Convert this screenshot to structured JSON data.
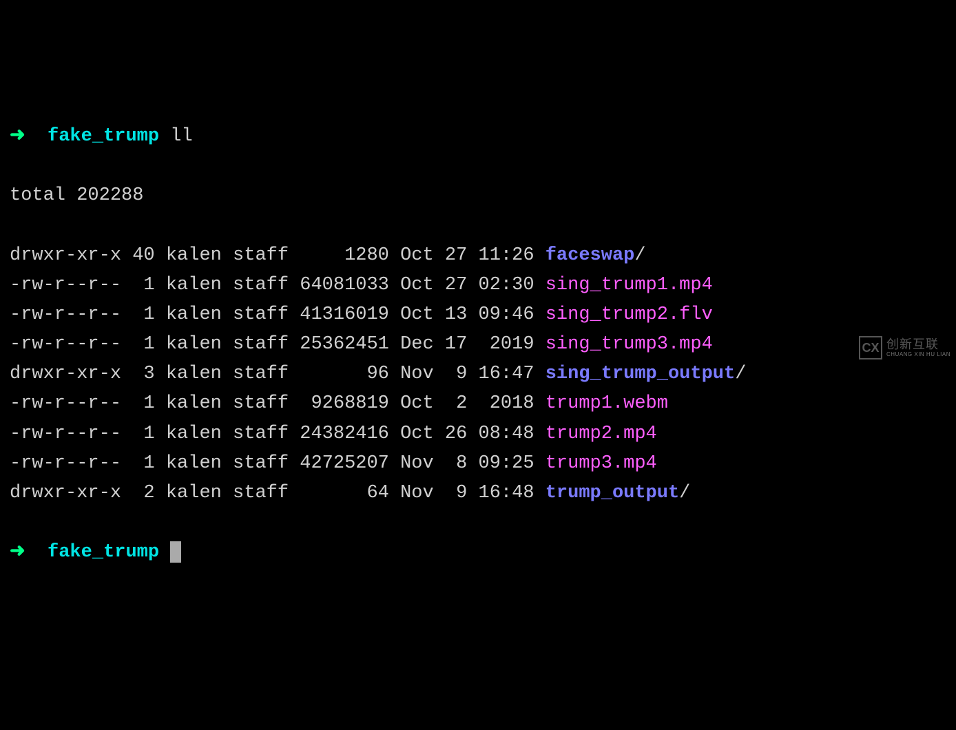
{
  "prompt_arrow": "➜",
  "cwd": "fake_trump",
  "cmd1": "ll",
  "total_line": "total 202288",
  "rows": [
    {
      "perm": "drwxr-xr-x",
      "links": "40",
      "owner": "kalen",
      "group": "staff",
      "size": "1280",
      "month": "Oct",
      "day": "27",
      "time": "11:26",
      "name": "faceswap",
      "suffix": "/",
      "type": "dir"
    },
    {
      "perm": "-rw-r--r--",
      "links": "1",
      "owner": "kalen",
      "group": "staff",
      "size": "64081033",
      "month": "Oct",
      "day": "27",
      "time": "02:30",
      "name": "sing_trump1.mp4",
      "suffix": "",
      "type": "file"
    },
    {
      "perm": "-rw-r--r--",
      "links": "1",
      "owner": "kalen",
      "group": "staff",
      "size": "41316019",
      "month": "Oct",
      "day": "13",
      "time": "09:46",
      "name": "sing_trump2.flv",
      "suffix": "",
      "type": "file"
    },
    {
      "perm": "-rw-r--r--",
      "links": "1",
      "owner": "kalen",
      "group": "staff",
      "size": "25362451",
      "month": "Dec",
      "day": "17",
      "time": "2019",
      "name": "sing_trump3.mp4",
      "suffix": "",
      "type": "file"
    },
    {
      "perm": "drwxr-xr-x",
      "links": "3",
      "owner": "kalen",
      "group": "staff",
      "size": "96",
      "month": "Nov",
      "day": "9",
      "time": "16:47",
      "name": "sing_trump_output",
      "suffix": "/",
      "type": "dir"
    },
    {
      "perm": "-rw-r--r--",
      "links": "1",
      "owner": "kalen",
      "group": "staff",
      "size": "9268819",
      "month": "Oct",
      "day": "2",
      "time": "2018",
      "name": "trump1.webm",
      "suffix": "",
      "type": "file"
    },
    {
      "perm": "-rw-r--r--",
      "links": "1",
      "owner": "kalen",
      "group": "staff",
      "size": "24382416",
      "month": "Oct",
      "day": "26",
      "time": "08:48",
      "name": "trump2.mp4",
      "suffix": "",
      "type": "file"
    },
    {
      "perm": "-rw-r--r--",
      "links": "1",
      "owner": "kalen",
      "group": "staff",
      "size": "42725207",
      "month": "Nov",
      "day": "8",
      "time": "09:25",
      "name": "trump3.mp4",
      "suffix": "",
      "type": "file"
    },
    {
      "perm": "drwxr-xr-x",
      "links": "2",
      "owner": "kalen",
      "group": "staff",
      "size": "64",
      "month": "Nov",
      "day": "9",
      "time": "16:48",
      "name": "trump_output",
      "suffix": "/",
      "type": "dir"
    }
  ],
  "watermark": {
    "logo": "CX",
    "cn": "创新互联",
    "en": "CHUANG XIN HU LIAN"
  }
}
